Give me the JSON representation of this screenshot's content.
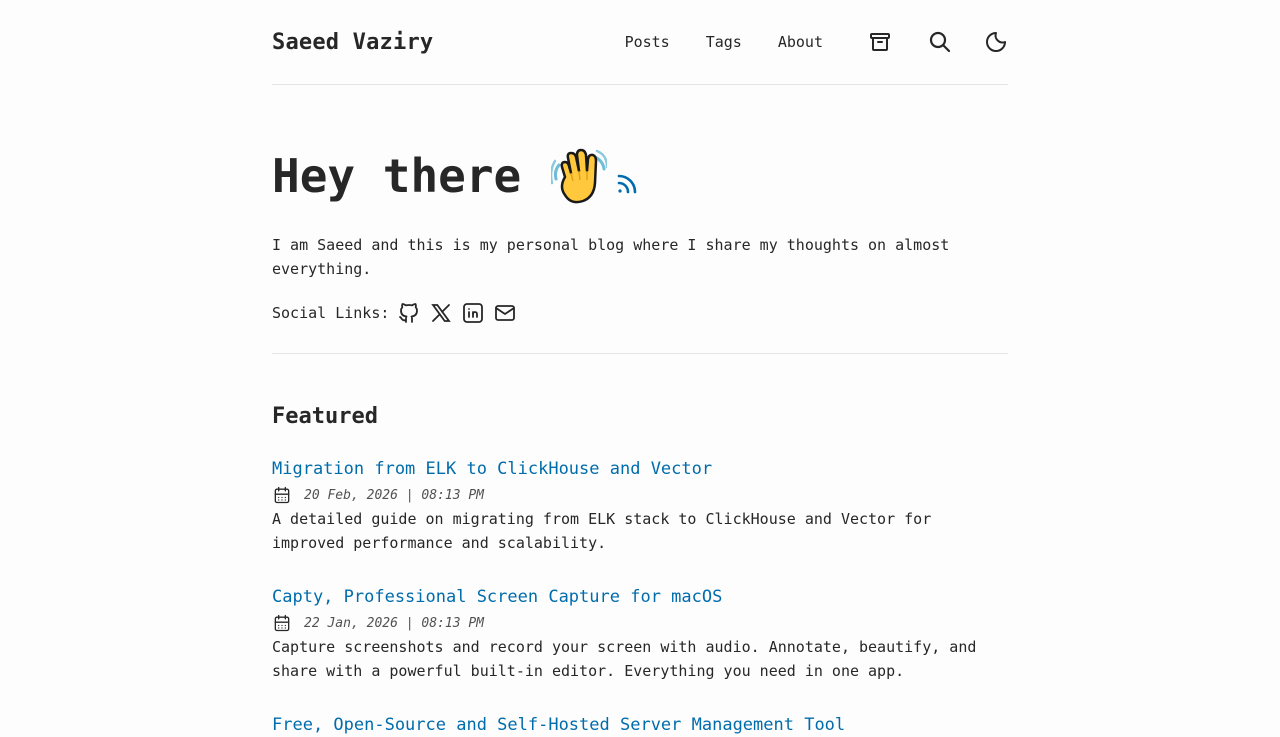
{
  "site": {
    "title": "Saeed Vaziry"
  },
  "nav": {
    "links": [
      "Posts",
      "Tags",
      "About"
    ],
    "icons": [
      "archive-icon",
      "search-icon",
      "moon-icon"
    ]
  },
  "hero": {
    "title": "Hey there",
    "emoji": "waving-hand-icon",
    "rss": "rss-icon",
    "description": "I am Saeed and this is my personal blog where I share my thoughts on almost everything.",
    "social_label": "Social Links:",
    "social_icons": [
      "github-icon",
      "x-icon",
      "linkedin-icon",
      "mail-icon"
    ]
  },
  "featured": {
    "heading": "Featured",
    "posts": [
      {
        "title": "Migration from ELK to ClickHouse and Vector",
        "date": "20 Feb, 2026 | 08:13 PM",
        "description": "A detailed guide on migrating from ELK stack to ClickHouse and Vector for improved performance and scalability."
      },
      {
        "title": "Capty, Professional Screen Capture for macOS",
        "date": "22 Jan, 2026 | 08:13 PM",
        "description": "Capture screenshots and record your screen with audio. Annotate, beautify, and share with a powerful built-in editor. Everything you need in one app."
      },
      {
        "title": "Free, Open-Source and Self-Hosted Server Management Tool"
      }
    ]
  },
  "colors": {
    "accent": "#006cac",
    "text": "#282728",
    "background": "#fdfdfd",
    "border": "#e5e5e5"
  }
}
